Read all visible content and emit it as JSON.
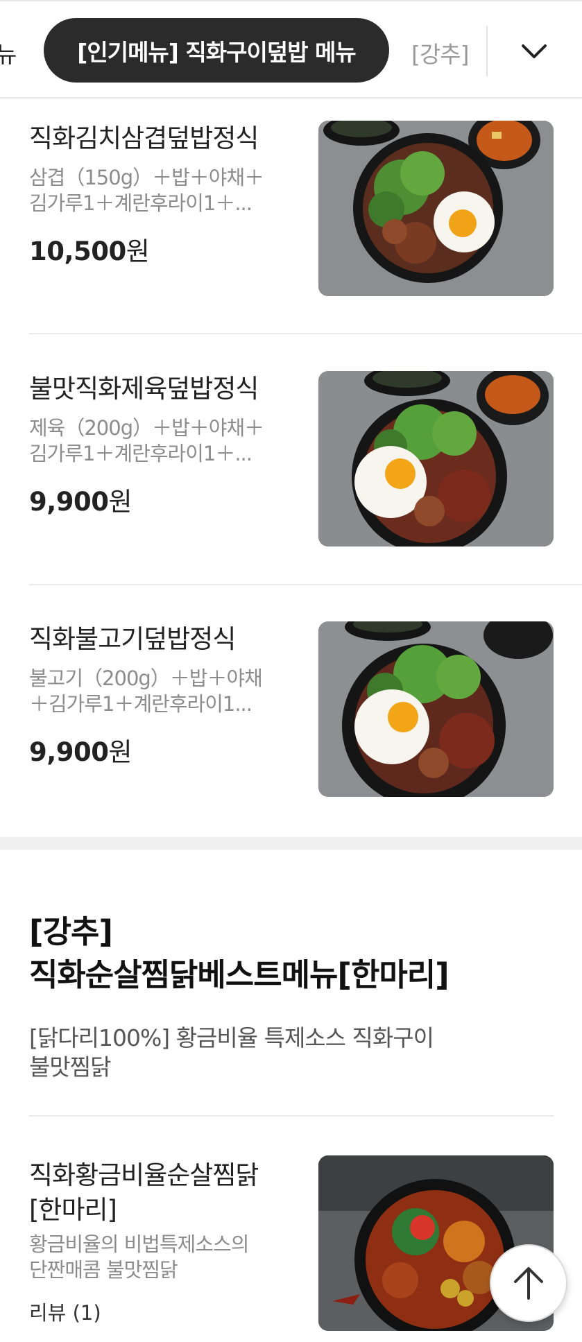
{
  "tabs": {
    "left_partial": "뉴",
    "active": "[인기메뉴] 직화구이덮밥 메뉴",
    "right_partial": "[강추]"
  },
  "items": [
    {
      "name": "직화김치삼겹덮밥정식",
      "desc": "삼겹（150g）＋밥＋야채＋\n김가루1＋계란후라이1＋...",
      "price": "10,500",
      "currency": "원",
      "image": "kimchi-pork-belly-rice-bowl-photo"
    },
    {
      "name": "불맛직화제육덮밥정식",
      "desc": "제육（200g）＋밥＋야채＋\n김가루1＋계란후라이1＋...",
      "price": "9,900",
      "currency": "원",
      "image": "spicy-pork-rice-bowl-photo"
    },
    {
      "name": "직화불고기덮밥정식",
      "desc": "불고기（200g）＋밥＋야채\n＋김가루1＋계란후라이1...",
      "price": "9,900",
      "currency": "원",
      "image": "bulgogi-rice-bowl-photo"
    }
  ],
  "section": {
    "title_line1": "[강추]",
    "title_line2": "직화순살찜닭베스트메뉴[한마리]",
    "desc": "[닭다리100%] 황금비율 특제소스 직화구이\n불맛찜닭"
  },
  "section_item": {
    "name": "직화황금비율순살찜닭\n[한마리]",
    "desc": "황금비율의 비법특제소스의\n단짠매콤 불맛찜닭",
    "review": "리뷰 (1)",
    "image": "braised-chicken-photo"
  },
  "icons": {
    "expand": "chevron-down-icon",
    "scroll_top": "arrow-up-icon"
  },
  "colors": {
    "active_tab_bg": "#2b2b2b",
    "active_tab_text": "#ffffff",
    "desc_text": "#8c8c8c"
  }
}
